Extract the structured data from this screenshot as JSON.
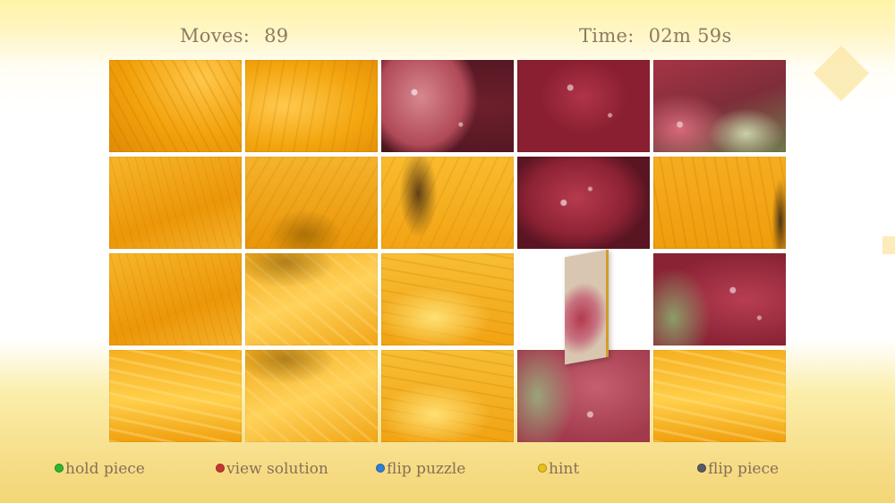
{
  "hud": {
    "moves_label": "Moves:",
    "moves_value": "89",
    "time_label": "Time:",
    "time_value": "02m 59s"
  },
  "puzzle": {
    "columns": 5,
    "rows": 4,
    "tiles": [
      "y1",
      "y2",
      "r1",
      "r2",
      "r3",
      "y3",
      "y4",
      "y7",
      "r4",
      "y8",
      "y3",
      "y5",
      "y6",
      "empty",
      "r5",
      "y9",
      "y5",
      "y6",
      "r6",
      "y9"
    ]
  },
  "controls": [
    {
      "button": "A",
      "color": "#2fb52f",
      "label": "hold piece"
    },
    {
      "button": "B",
      "color": "#c8352e",
      "label": "view solution"
    },
    {
      "button": "X",
      "color": "#2f7fd3",
      "label": "flip puzzle"
    },
    {
      "button": "Y",
      "color": "#e6c21b",
      "label": "hint"
    },
    {
      "button": "LS",
      "color": "#555a66",
      "label": "flip piece"
    }
  ]
}
